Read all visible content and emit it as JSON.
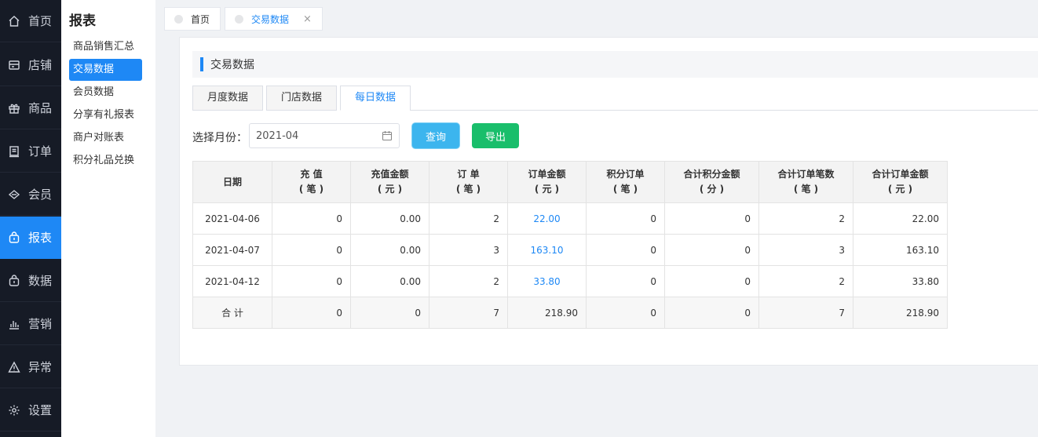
{
  "nav": [
    {
      "label": "首页",
      "icon": "home-icon"
    },
    {
      "label": "店铺",
      "icon": "store-icon"
    },
    {
      "label": "商品",
      "icon": "gift-icon"
    },
    {
      "label": "订单",
      "icon": "order-icon"
    },
    {
      "label": "会员",
      "icon": "member-icon"
    },
    {
      "label": "报表",
      "icon": "report-icon"
    },
    {
      "label": "数据",
      "icon": "data-icon"
    },
    {
      "label": "营销",
      "icon": "chart-bar-icon"
    },
    {
      "label": "异常",
      "icon": "warning-icon"
    },
    {
      "label": "设置",
      "icon": "gear-icon"
    }
  ],
  "submenu": {
    "title": "报表",
    "items": [
      "商品销售汇总",
      "交易数据",
      "会员数据",
      "分享有礼报表",
      "商户对账表",
      "积分礼品兑换"
    ]
  },
  "toptabs": [
    {
      "label": "首页"
    },
    {
      "label": "交易数据",
      "close": "×"
    }
  ],
  "section": {
    "title": "交易数据"
  },
  "subtabs": [
    "月度数据",
    "门店数据",
    "每日数据"
  ],
  "filter": {
    "label": "选择月份：",
    "month": "2021-04"
  },
  "buttons": {
    "query": "查询",
    "export": "导出"
  },
  "table": {
    "headers": [
      [
        "日期"
      ],
      [
        "充 值",
        "( 笔 )"
      ],
      [
        "充值金额",
        "( 元 )"
      ],
      [
        "订 单",
        "( 笔 )"
      ],
      [
        "订单金额",
        "( 元 )"
      ],
      [
        "积分订单",
        "( 笔 )"
      ],
      [
        "合计积分金额",
        "( 分 )"
      ],
      [
        "合计订单笔数",
        "( 笔 )"
      ],
      [
        "合计订单金额",
        "( 元 )"
      ]
    ],
    "rows": [
      [
        "2021-04-06",
        "0",
        "0.00",
        "2",
        "22.00",
        "0",
        "0",
        "2",
        "22.00"
      ],
      [
        "2021-04-07",
        "0",
        "0.00",
        "3",
        "163.10",
        "0",
        "0",
        "3",
        "163.10"
      ],
      [
        "2021-04-12",
        "0",
        "0.00",
        "2",
        "33.80",
        "0",
        "0",
        "2",
        "33.80"
      ]
    ],
    "total": [
      "合 计",
      "0",
      "0",
      "7",
      "218.90",
      "0",
      "0",
      "7",
      "218.90"
    ]
  },
  "colors": {
    "accent": "#1e88f5",
    "query": "#3cb5ee",
    "export": "#19be6b",
    "nav_bg": "#161b26"
  }
}
